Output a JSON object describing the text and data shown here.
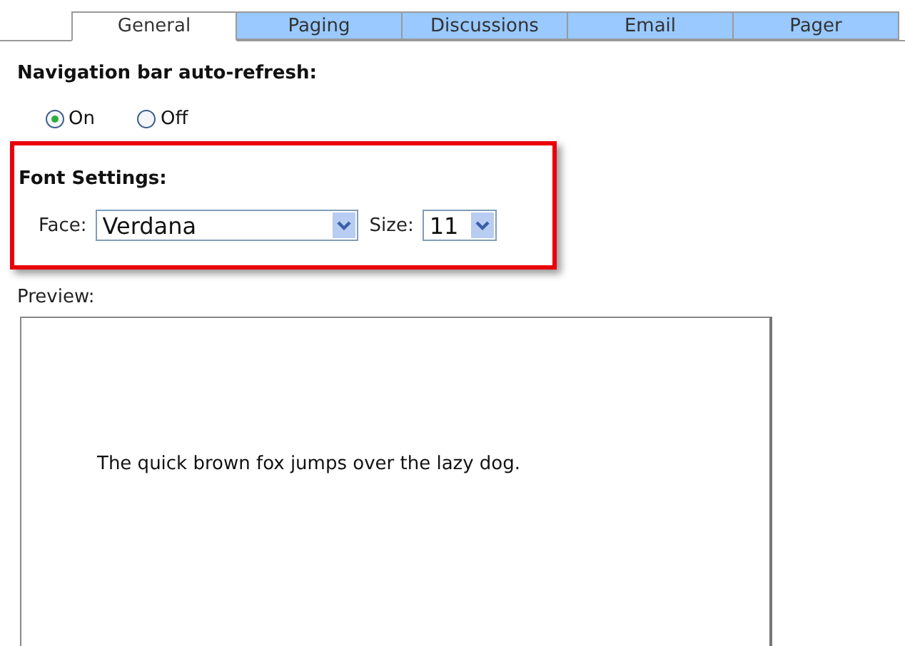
{
  "tabs": [
    {
      "label": "General",
      "selected": true
    },
    {
      "label": "Paging",
      "selected": false
    },
    {
      "label": "Discussions",
      "selected": false
    },
    {
      "label": "Email",
      "selected": false
    },
    {
      "label": "Pager",
      "selected": false
    }
  ],
  "auto_refresh": {
    "heading": "Navigation bar auto-refresh:",
    "options": [
      {
        "label": "On",
        "selected": true
      },
      {
        "label": "Off",
        "selected": false
      }
    ]
  },
  "font_settings": {
    "heading": "Font Settings:",
    "face_label": "Face:",
    "face_value": "Verdana",
    "size_label": "Size:",
    "size_value": "11"
  },
  "preview": {
    "label": "Preview:",
    "text": "The quick brown fox jumps over the lazy dog."
  }
}
